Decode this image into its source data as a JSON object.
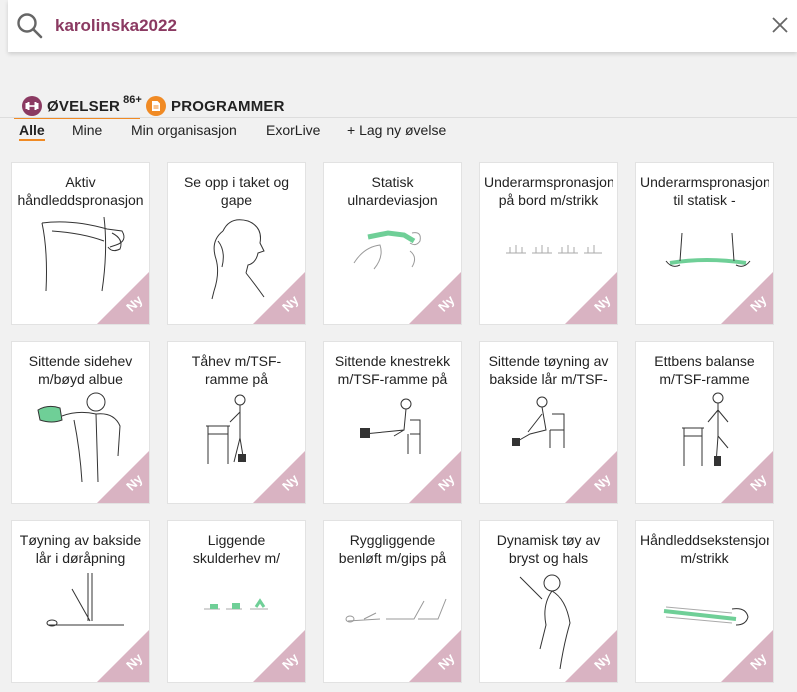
{
  "search": {
    "query": "karolinska2022"
  },
  "categories": {
    "exercises": {
      "label": "ØVELSER",
      "badge": "86+"
    },
    "programs": {
      "label": "PROGRAMMER"
    }
  },
  "filters": [
    "Alle",
    "Mine",
    "Min organisasjon",
    "ExorLive",
    "+ Lag ny øvelse"
  ],
  "badge_label": "Ny",
  "colors": {
    "accent": "#f08a24",
    "brand": "#8b3a62",
    "ribbon": "#d9b3c2",
    "band_green": "#6fcf97"
  },
  "cards": [
    {
      "title": "Aktiv håndleddspronasjon",
      "icon": "forearm-pronation-drawing"
    },
    {
      "title": "Se opp i taket og gape",
      "icon": "head-tilt-drawing"
    },
    {
      "title": "Statisk ulnardeviasjon",
      "icon": "wrist-band-drawing"
    },
    {
      "title": "Underarmspronasjon på bord m/strikk",
      "icon": "hands-on-table-drawing"
    },
    {
      "title": "Underarmspronasjon til statisk -",
      "icon": "band-stretch-drawing"
    },
    {
      "title": "Sittende sidehev m/bøyd albue",
      "icon": "seated-lateral-raise-drawing"
    },
    {
      "title": "Tåhev m/TSF-ramme på",
      "icon": "toe-raise-frame-drawing"
    },
    {
      "title": "Sittende knestrekk m/TSF-ramme på",
      "icon": "seated-knee-extension-drawing"
    },
    {
      "title": "Sittende tøyning av bakside lår m/TSF-",
      "icon": "seated-hamstring-stretch-drawing"
    },
    {
      "title": "Ettbens balanse m/TSF-ramme",
      "icon": "single-leg-balance-drawing"
    },
    {
      "title": "Tøyning av bakside lår i døråpning",
      "icon": "doorway-hamstring-stretch-drawing"
    },
    {
      "title": "Liggende skulderhev m/",
      "icon": "lying-shoulder-raise-drawing"
    },
    {
      "title": "Ryggliggende benløft m/gips på",
      "icon": "supine-leg-lift-drawing"
    },
    {
      "title": "Dynamisk tøy av bryst og hals",
      "icon": "chest-neck-stretch-drawing"
    },
    {
      "title": "Håndleddsekstensjon m/strikk",
      "icon": "wrist-extension-band-drawing"
    }
  ]
}
